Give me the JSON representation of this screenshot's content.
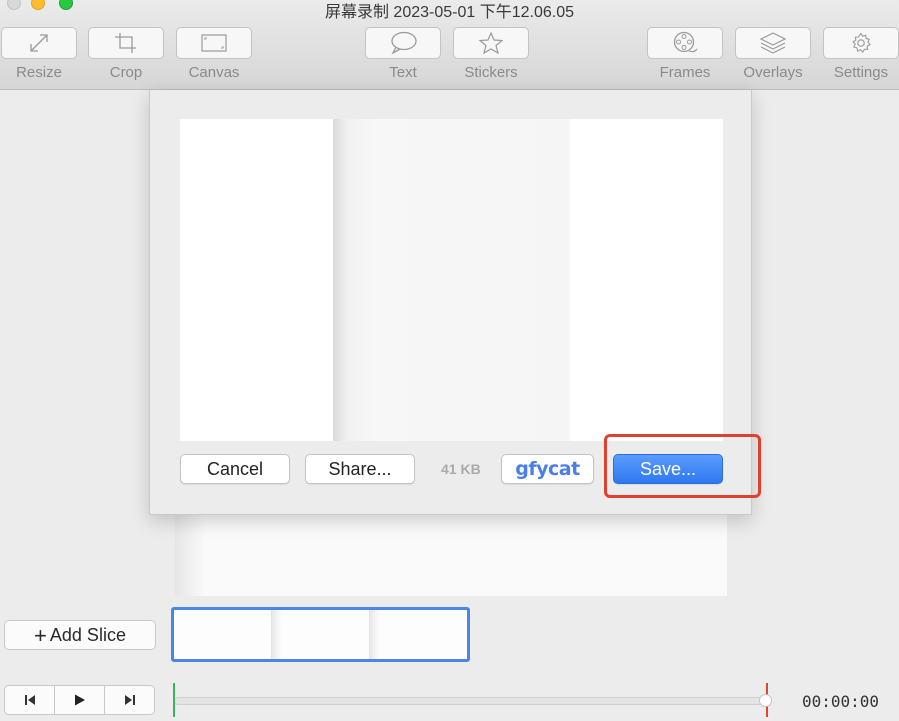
{
  "window": {
    "title": "屏幕录制 2023-05-01 下午12.06.05"
  },
  "toolbar": {
    "resize": "Resize",
    "crop": "Crop",
    "canvas": "Canvas",
    "text": "Text",
    "stickers": "Stickers",
    "frames": "Frames",
    "overlays": "Overlays",
    "settings": "Settings"
  },
  "export_sheet": {
    "cancel": "Cancel",
    "share": "Share...",
    "file_size": "41 KB",
    "gfycat": "gfycat",
    "save": "Save..."
  },
  "editor": {
    "add_slice": "Add Slice",
    "add_slice_symbol": "+",
    "timecode": "00:00:00"
  },
  "colors": {
    "save_button": "#2f78f0",
    "highlight": "#e0402f",
    "slice_selection": "#4a86e8",
    "timeline_start": "#3db35a",
    "timeline_end": "#e0452f"
  },
  "icons": [
    "resize-icon",
    "crop-icon",
    "canvas-icon",
    "text-icon",
    "stickers-icon",
    "frames-icon",
    "overlays-icon",
    "settings-icon",
    "skip-back-icon",
    "play-icon",
    "skip-forward-icon"
  ]
}
